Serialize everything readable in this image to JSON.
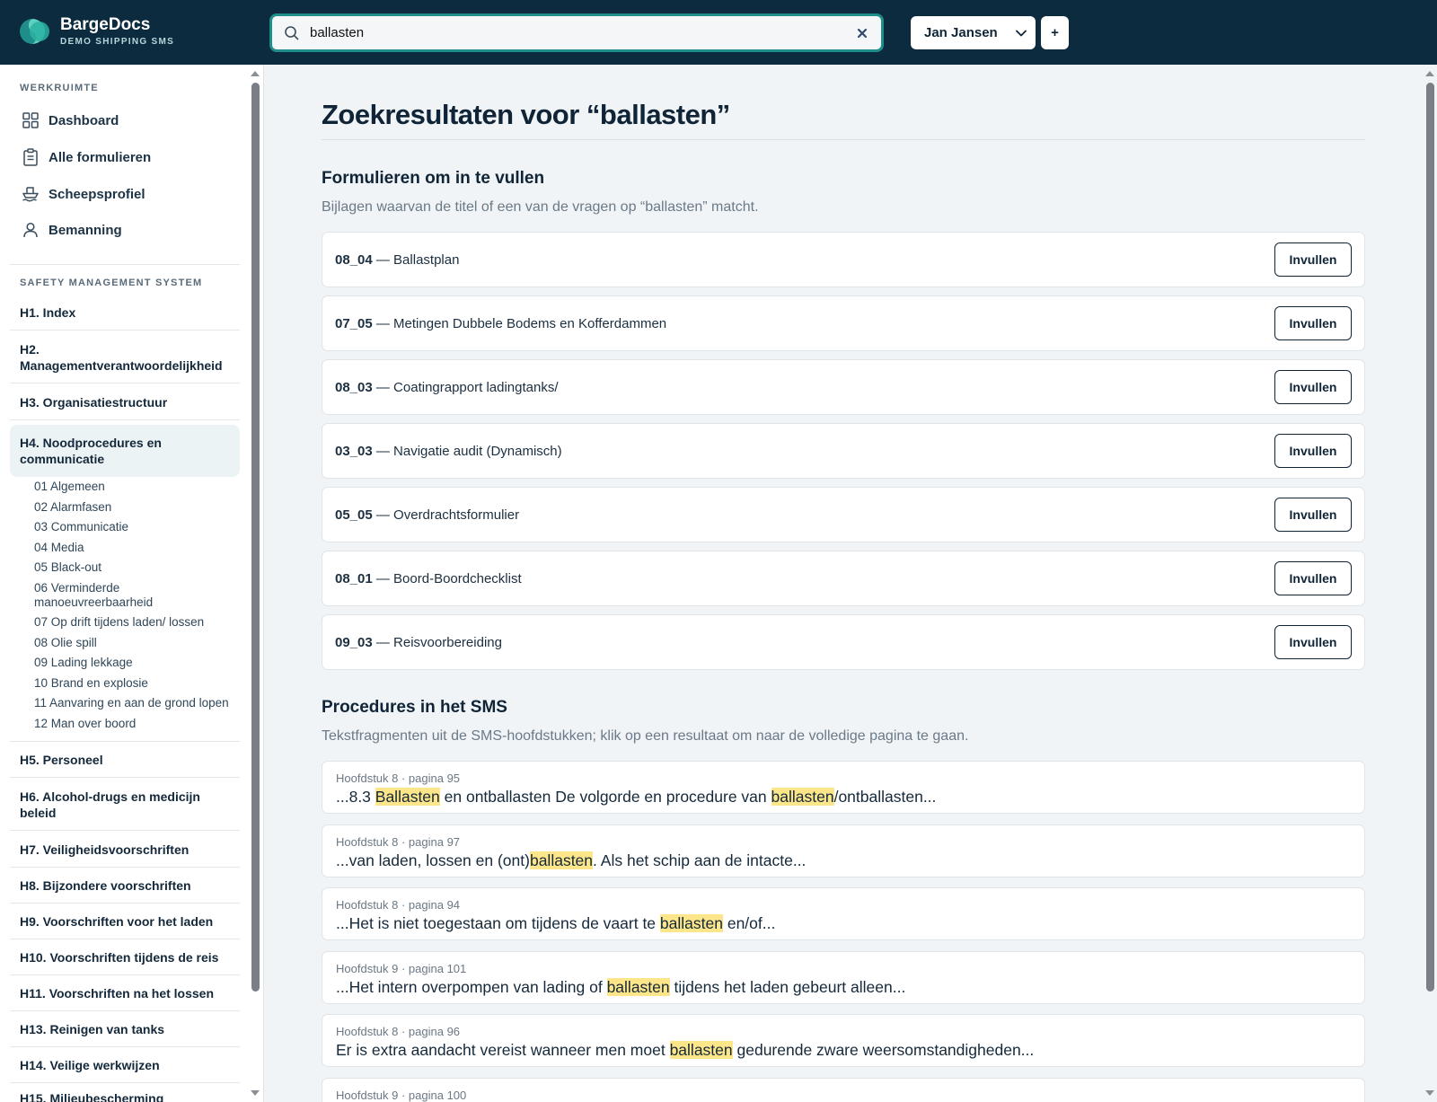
{
  "app": {
    "brand": "BargeDocs",
    "tagline": "DEMO SHIPPING SMS"
  },
  "search": {
    "value": "ballasten",
    "placeholder": ""
  },
  "user": {
    "name": "Jan Jansen",
    "add_label": "+"
  },
  "sidebar": {
    "workspace_heading": "WERKRUIMTE",
    "workspace_items": [
      {
        "label": "Dashboard",
        "icon": "dashboard-grid-icon"
      },
      {
        "label": "Alle formulieren",
        "icon": "clipboard-icon"
      },
      {
        "label": "Scheepsprofiel",
        "icon": "ship-icon"
      },
      {
        "label": "Bemanning",
        "icon": "user-icon"
      }
    ],
    "sms_heading": "SAFETY MANAGEMENT SYSTEM",
    "chapters": [
      {
        "label": "H1. Index"
      },
      {
        "label": "H2. Managementverantwoordelijkheid"
      },
      {
        "label": "H3. Organisatiestructuur"
      },
      {
        "label": "H4. Noodprocedures en communicatie"
      },
      {
        "label": "H5. Personeel"
      },
      {
        "label": "H6. Alcohol-drugs en medicijn beleid"
      },
      {
        "label": "H7. Veiligheidsvoorschriften"
      },
      {
        "label": "H8. Bijzondere voorschriften"
      },
      {
        "label": "H9. Voorschriften voor het laden"
      },
      {
        "label": "H10. Voorschriften tijdens de reis"
      },
      {
        "label": "H11. Voorschriften na het lossen"
      },
      {
        "label": "H13. Reinigen van tanks"
      },
      {
        "label": "H14. Veilige werkwijzen"
      },
      {
        "label": "H15. Milieubescherming"
      }
    ],
    "subsections": [
      "01 Algemeen",
      "02 Alarmfasen",
      "03 Communicatie",
      "04 Media",
      "05 Black-out",
      "06 Verminderde manoeuvreerbaarheid",
      "07 Op drift tijdens laden/ lossen",
      "08 Olie spill",
      "09 Lading lekkage",
      "10 Brand en explosie",
      "11 Aanvaring en aan de grond lopen",
      "12 Man over boord"
    ]
  },
  "main": {
    "title": "Zoekresultaten voor “ballasten”",
    "forms_section": {
      "title": "Formulieren om in te vullen",
      "description": "Bijlagen waarvan de titel of een van de vragen op “ballasten” matcht.",
      "button_label": "Invullen",
      "items": [
        {
          "code": "08_04",
          "name": " — Ballastplan"
        },
        {
          "code": "07_05",
          "name": " — Metingen Dubbele Bodems en Kofferdammen"
        },
        {
          "code": "08_03",
          "name": " — Coatingrapport ladingtanks/"
        },
        {
          "code": "03_03",
          "name": " — Navigatie audit (Dynamisch)"
        },
        {
          "code": "05_05",
          "name": " — Overdrachtsformulier"
        },
        {
          "code": "08_01",
          "name": " — Boord-Boordchecklist"
        },
        {
          "code": "09_03",
          "name": " — Reisvoorbereiding"
        }
      ]
    },
    "procedures_section": {
      "title": "Procedures in het SMS",
      "description": "Tekstfragmenten uit de SMS-hoofdstukken; klik op een resultaat om naar de volledige pagina te gaan.",
      "items": [
        {
          "meta": "Hoofdstuk 8 · pagina 95",
          "parts": [
            [
              "...8.3 ",
              false
            ],
            [
              "Ballasten",
              true
            ],
            [
              " en ontballasten De volgorde en procedure van ",
              false
            ],
            [
              "ballasten",
              true
            ],
            [
              "/ontballasten...",
              false
            ]
          ]
        },
        {
          "meta": "Hoofdstuk 8 · pagina 97",
          "parts": [
            [
              "...van laden, lossen en (ont)",
              false
            ],
            [
              "ballasten",
              true
            ],
            [
              ". Als het schip aan de intacte...",
              false
            ]
          ]
        },
        {
          "meta": "Hoofdstuk 8 · pagina 94",
          "parts": [
            [
              "...Het is niet toegestaan om tijdens de vaart te ",
              false
            ],
            [
              "ballasten",
              true
            ],
            [
              " en/of...",
              false
            ]
          ]
        },
        {
          "meta": "Hoofdstuk 9 · pagina 101",
          "parts": [
            [
              "...Het intern overpompen van lading of ",
              false
            ],
            [
              "ballasten",
              true
            ],
            [
              " tijdens het laden gebeurt alleen...",
              false
            ]
          ]
        },
        {
          "meta": "Hoofdstuk 8 · pagina 96",
          "parts": [
            [
              "Er is extra aandacht vereist wanneer men moet ",
              false
            ],
            [
              "ballasten",
              true
            ],
            [
              " gedurende zware weersomstandigheden...",
              false
            ]
          ]
        },
        {
          "meta": "Hoofdstuk 9 · pagina 100",
          "parts": []
        }
      ]
    }
  },
  "colors": {
    "topbar": "#0d2b3e",
    "accent": "#1f8d8a",
    "highlight": "#fde68a"
  }
}
